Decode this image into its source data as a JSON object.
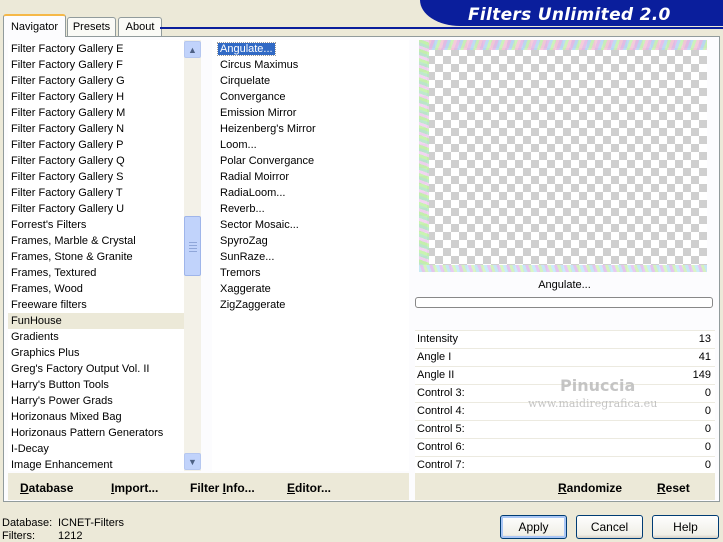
{
  "tabs": [
    {
      "label": "Navigator",
      "active": true
    },
    {
      "label": "Presets",
      "active": false
    },
    {
      "label": "About",
      "active": false
    }
  ],
  "banner": {
    "title": "Filters Unlimited 2.0"
  },
  "categories": {
    "items": [
      "Filter Factory Gallery E",
      "Filter Factory Gallery F",
      "Filter Factory Gallery G",
      "Filter Factory Gallery H",
      "Filter Factory Gallery M",
      "Filter Factory Gallery N",
      "Filter Factory Gallery P",
      "Filter Factory Gallery Q",
      "Filter Factory Gallery S",
      "Filter Factory Gallery T",
      "Filter Factory Gallery U",
      "Forrest's Filters",
      "Frames, Marble & Crystal",
      "Frames, Stone & Granite",
      "Frames, Textured",
      "Frames, Wood",
      "Freeware filters",
      "FunHouse",
      "Gradients",
      "Graphics Plus",
      "Greg's Factory Output Vol. II",
      "Harry's Button Tools",
      "Harry's Power Grads",
      "Horizonaus Mixed Bag",
      "Horizonaus Pattern Generators",
      "I-Decay",
      "Image Enhancement"
    ],
    "selected_index": 17
  },
  "filters": {
    "items": [
      "Angulate...",
      "Circus Maximus",
      "Cirquelate",
      "Convergance",
      "Emission Mirror",
      "Heizenberg's Mirror",
      "Loom...",
      "Polar Convergance",
      "Radial Moirror",
      "RadiaLoom...",
      "Reverb...",
      "Sector Mosaic...",
      "SpyroZag",
      "SunRaze...",
      "Tremors",
      "Xaggerate",
      "ZigZaggerate"
    ],
    "selected_index": 0
  },
  "preview": {
    "filter_name": "Angulate..."
  },
  "controls": [
    {
      "label": "Intensity",
      "value": "13"
    },
    {
      "label": "Angle I",
      "value": "41"
    },
    {
      "label": "Angle II",
      "value": "149"
    },
    {
      "label": "Control 3:",
      "value": "0"
    },
    {
      "label": "Control 4:",
      "value": "0"
    },
    {
      "label": "Control 5:",
      "value": "0"
    },
    {
      "label": "Control 6:",
      "value": "0"
    },
    {
      "label": "Control 7:",
      "value": "0"
    }
  ],
  "bottom_bar": {
    "database": {
      "u": "D",
      "rest": "atabase"
    },
    "import": {
      "u": "I",
      "rest": "mport..."
    },
    "filter_info": {
      "pre": "Filter ",
      "u": "I",
      "rest": "nfo..."
    },
    "editor": {
      "u": "E",
      "rest": "ditor..."
    },
    "randomize": {
      "u": "R",
      "rest": "andomize"
    },
    "reset": {
      "u": "R",
      "rest": "eset"
    }
  },
  "watermark": {
    "line1": "Pinuccia",
    "line2": "www.maidiregrafica.eu"
  },
  "info": {
    "database_label": "Database:",
    "database_value": "ICNET-Filters",
    "filters_label": "Filters:",
    "filters_value": "1212"
  },
  "buttons": {
    "apply": "Apply",
    "cancel": "Cancel",
    "help": "Help"
  },
  "colors": {
    "banner": "#0a1e9c",
    "selection": "#316ac5",
    "window_bg": "#ece9d8"
  }
}
